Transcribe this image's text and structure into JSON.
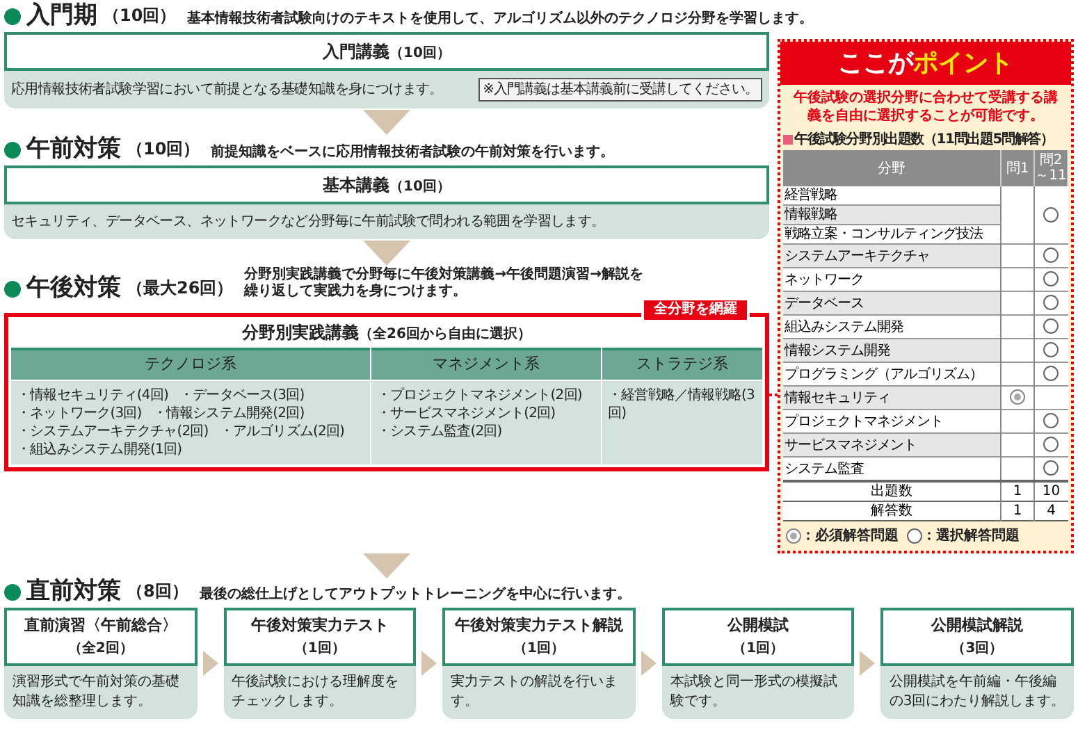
{
  "phases": [
    {
      "kind": "single",
      "title": "入門期",
      "count": "（10回）",
      "desc": [
        "基本情報技術者試験向けのテキストを使用して、アルゴリズム以外のテクノロジ分野を学習します。"
      ],
      "box": {
        "title": "入門講義",
        "count": "（10回）",
        "body": "応用情報技術者試験学習において前提となる基礎知識を身につけます。",
        "note": "※入門講義は基本講義前に受講してください。"
      }
    },
    {
      "kind": "single",
      "title": "午前対策",
      "count": "（10回）",
      "desc": [
        "前提知識をベースに応用情報技術者試験の午前対策を行います。"
      ],
      "box": {
        "title": "基本講義",
        "count": "（10回）",
        "body": "セキュリティ、データベース、ネットワークなど分野毎に午前試験で問われる範囲を学習します。"
      }
    },
    {
      "kind": "practice",
      "title": "午後対策",
      "count": "（最大26回）",
      "desc": [
        "分野別実践講義で分野毎に午後対策講義→午後問題演習→解説を",
        "繰り返して実践力を身につけます。"
      ],
      "box": {
        "tag": "全分野を網羅",
        "title": "分野別実践講義",
        "count": "（全26回から自由に選択）",
        "columns": [
          {
            "heading": "テクノロジ系",
            "items": [
              "・情報セキュリティ(4回)",
              "・データベース(3回)",
              "・ネットワーク(3回)",
              "・情報システム開発(2回)",
              "・システムアーキテクチャ(2回)",
              "・アルゴリズム(2回)",
              "・組込みシステム開発(1回)"
            ]
          },
          {
            "heading": "マネジメント系",
            "items": [
              "・プロジェクトマネジメント(2回)",
              "・サービスマネジメント(2回)",
              "・システム監査(2回)"
            ]
          },
          {
            "heading": "ストラテジ系",
            "items": [
              "・経営戦略／情報戦略(3回)"
            ]
          }
        ]
      }
    },
    {
      "kind": "steps",
      "title": "直前対策",
      "count": "（8回）",
      "desc": [
        "最後の総仕上げとしてアウトプットトレーニングを中心に行います。"
      ],
      "steps": [
        {
          "title": "直前演習〈午前総合〉",
          "count": "（全2回）",
          "body": "演習形式で午前対策の基礎知識を総整理します。"
        },
        {
          "title": "午後対策実力テスト",
          "count": "（1回）",
          "body": "午後試験における理解度をチェックします。"
        },
        {
          "title": "午後対策実力テスト解説",
          "count": "（1回）",
          "body": "実力テストの解説を行います。"
        },
        {
          "title": "公開模試",
          "count": "（1回）",
          "body": "本試験と同一形式の模擬試験です。"
        },
        {
          "title": "公開模試解説",
          "count": "（3回）",
          "body": "公開模試を午前編・午後編の3回にわたり解説します。"
        }
      ]
    }
  ],
  "point_panel": {
    "title_lead": "ここが",
    "title_accent": "ポイント",
    "lead": "午後試験の選択分野に合わせて受講する講義を自由に選択することが可能です。",
    "table_title": "午後試験分野別出題数（11問出題5問解答）",
    "columns": [
      "分野",
      "問1",
      "問2\n～11"
    ],
    "groups": [
      {
        "fields": [
          "経営戦略",
          "情報戦略",
          "戦略立案・コンサルティング技法"
        ],
        "q1_required": false,
        "q2_optional": true
      },
      {
        "fields": [
          "システムアーキテクチャ"
        ],
        "q1_required": false,
        "q2_optional": true
      },
      {
        "fields": [
          "ネットワーク"
        ],
        "q1_required": false,
        "q2_optional": true
      },
      {
        "fields": [
          "データベース"
        ],
        "q1_required": false,
        "q2_optional": true
      },
      {
        "fields": [
          "組込みシステム開発"
        ],
        "q1_required": false,
        "q2_optional": true
      },
      {
        "fields": [
          "情報システム開発"
        ],
        "q1_required": false,
        "q2_optional": true
      },
      {
        "fields": [
          "プログラミング（アルゴリズム）"
        ],
        "q1_required": false,
        "q2_optional": true
      },
      {
        "fields": [
          "情報セキュリティ"
        ],
        "q1_required": true,
        "q2_optional": false
      },
      {
        "fields": [
          "プロジェクトマネジメント"
        ],
        "q1_required": false,
        "q2_optional": true
      },
      {
        "fields": [
          "サービスマネジメント"
        ],
        "q1_required": false,
        "q2_optional": true
      },
      {
        "fields": [
          "システム監査"
        ],
        "q1_required": false,
        "q2_optional": true
      }
    ],
    "summary": [
      {
        "label": "出題数",
        "q1": "1",
        "q2": "10"
      },
      {
        "label": "解答数",
        "q1": "1",
        "q2": "4"
      }
    ],
    "legend": [
      {
        "kind": "required",
        "label": "：必須解答問題"
      },
      {
        "kind": "optional",
        "label": "：選択解答問題"
      }
    ]
  }
}
